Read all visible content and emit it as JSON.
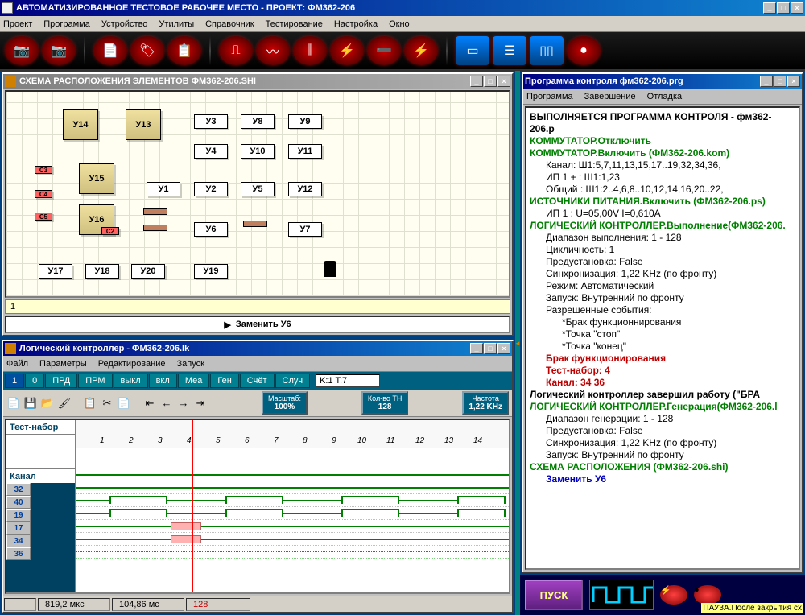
{
  "main": {
    "title": "АВТОМАТИЗИРОВАННОЕ ТЕСТОВОЕ РАБОЧЕЕ МЕСТО  - ПРОЕКТ: ФМ362-206",
    "menu": [
      "Проект",
      "Программа",
      "Устройство",
      "Утилиты",
      "Справочник",
      "Тестирование",
      "Настройка",
      "Окно"
    ]
  },
  "schema": {
    "title": "СХЕМА РАСПОЛОЖЕНИЯ ЭЛЕМЕНТОВ ФМ362-206.SHI",
    "status_num": "1",
    "replace_text": "Заменить  У6",
    "chips": {
      "y14": "У14",
      "y13": "У13",
      "y15": "У15",
      "y16": "У16",
      "y1": "У1",
      "y2": "У2",
      "y3": "У3",
      "y4": "У4",
      "y5": "У5",
      "y6": "У6",
      "y8": "У8",
      "y9": "У9",
      "y10": "У10",
      "y11": "У11",
      "y12": "У12",
      "y7": "У7",
      "y17": "У17",
      "y18": "У18",
      "y19": "У19",
      "y20": "У20",
      "c3": "C3",
      "c4": "C4",
      "c5": "C5",
      "c2": "C2"
    }
  },
  "logic": {
    "title": "Логический контроллер - ФМ362-206.lk",
    "menu": [
      "Файл",
      "Параметры",
      "Редактирование",
      "Запуск"
    ],
    "tabs": [
      "1",
      "0",
      "ПРД",
      "ПРМ",
      "выкл",
      "вкл",
      "Меа",
      "Ген",
      "Счёт",
      "Случ"
    ],
    "tab_input": "K:1 T:7",
    "scale": {
      "label": "Масштаб:",
      "value": "100%"
    },
    "count": {
      "label": "Кол-во ТН",
      "value": "128"
    },
    "freq": {
      "label": "Частота",
      "value": "1,22 KHz"
    },
    "test_set": "Тест-набор",
    "channel": "Канал",
    "channels": [
      "32",
      "40",
      "19",
      "17",
      "34",
      "36"
    ],
    "ruler_nums": [
      "1",
      "2",
      "3",
      "4",
      "5",
      "6",
      "7",
      "8",
      "9",
      "10",
      "11",
      "12",
      "13",
      "14"
    ],
    "status": {
      "s1": "819,2 мкс",
      "s2": "104,86 мс",
      "s3": "128"
    }
  },
  "prog": {
    "title": "Программа контроля фм362-206.prg",
    "menu": [
      "Программа",
      "Завершение",
      "Отладка"
    ],
    "lines": [
      {
        "cls": "bold",
        "text": "ВЫПОЛНЯЕТСЯ ПРОГРАММА КОНТРОЛЯ - фм362-206.p"
      },
      {
        "cls": "bold green",
        "text": "КОММУТАТОР.Отключить"
      },
      {
        "cls": "bold green",
        "text": "КОММУТАТОР.Включить (ФМ362-206.kom)"
      },
      {
        "cls": "indent",
        "text": "Канал:  Ш1:5,7,11,13,15,17..19,32,34,36,"
      },
      {
        "cls": "indent",
        "text": "ИП 1 + : Ш1:1,23"
      },
      {
        "cls": "indent",
        "text": "Общий : Ш1:2..4,6,8..10,12,14,16,20..22,"
      },
      {
        "cls": "bold green",
        "text": "ИСТОЧНИКИ ПИТАНИЯ.Включить (ФМ362-206.ps)"
      },
      {
        "cls": "indent",
        "text": "ИП 1  : U=05,00V I=0,610A"
      },
      {
        "cls": "bold green",
        "text": "ЛОГИЧЕСКИЙ КОНТРОЛЛЕР.Выполнение(ФМ362-206."
      },
      {
        "cls": "indent",
        "text": "Диапазон выполнения: 1 - 128"
      },
      {
        "cls": "indent",
        "text": "Цикличность: 1"
      },
      {
        "cls": "indent",
        "text": "Предустановка: False"
      },
      {
        "cls": "indent",
        "text": "Синхронизация: 1,22 KHz (по фронту)"
      },
      {
        "cls": "indent",
        "text": "Режим: Автоматический"
      },
      {
        "cls": "indent",
        "text": "Запуск: Внутренний по фронту"
      },
      {
        "cls": "indent",
        "text": "Разрешенные события:"
      },
      {
        "cls": "indent2",
        "text": "*Брак функционнирования"
      },
      {
        "cls": "indent2",
        "text": "*Точка \"стоп\""
      },
      {
        "cls": "indent2",
        "text": "*Точка \"конец\""
      },
      {
        "cls": "",
        "text": " "
      },
      {
        "cls": "bold red indent",
        "text": "Брак функционирования"
      },
      {
        "cls": "bold red indent",
        "text": "Тест-набор: 4"
      },
      {
        "cls": "bold red indent",
        "text": "Канал: 34 36"
      },
      {
        "cls": "bold",
        "text": "Логический контроллер завершил работу (\"БРА"
      },
      {
        "cls": "bold green",
        "text": "ЛОГИЧЕСКИЙ КОНТРОЛЛЕР.Генерация(ФМ362-206.l"
      },
      {
        "cls": "indent",
        "text": "Диапазон генерации: 1 - 128"
      },
      {
        "cls": "indent",
        "text": "Предустановка: False"
      },
      {
        "cls": "indent",
        "text": "Синхронизация: 1,22 KHz (по фронту)"
      },
      {
        "cls": "indent",
        "text": "Запуск: Внутренний по фронту"
      },
      {
        "cls": "bold green",
        "text": "СХЕМА РАСПОЛОЖЕНИЯ (ФМ362-206.shi)"
      },
      {
        "cls": "bold blue indent",
        "text": "Заменить  У6"
      }
    ]
  },
  "bottom": {
    "pusk": "ПУСК",
    "pause": "ПАУЗА.После закрытия сх"
  }
}
